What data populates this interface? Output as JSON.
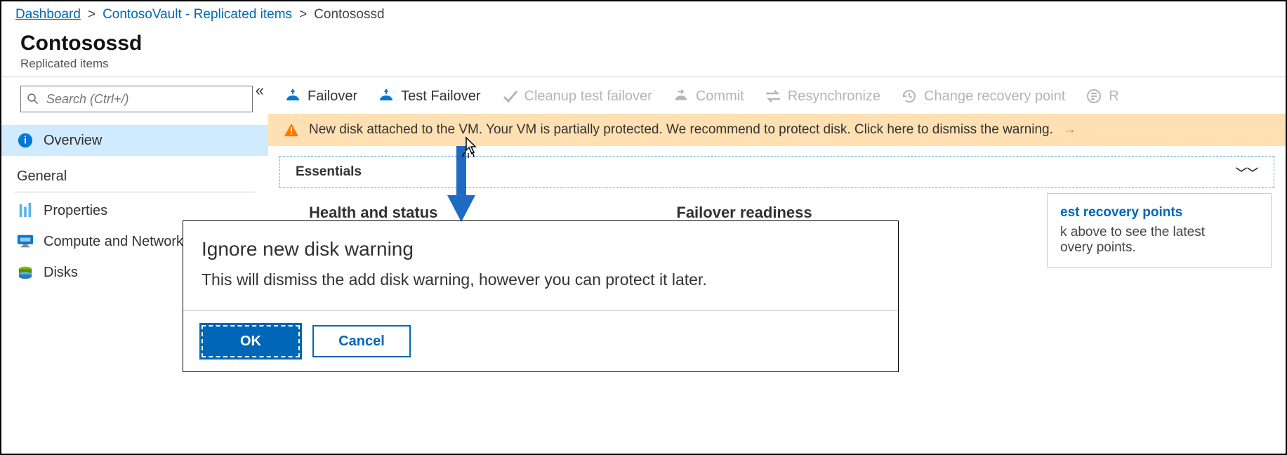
{
  "breadcrumb": {
    "dashboard": "Dashboard",
    "vault": "ContosoVault - Replicated items",
    "current": "Contosossd"
  },
  "header": {
    "title": "Contosossd",
    "subtitle": "Replicated items"
  },
  "search": {
    "placeholder": "Search (Ctrl+/)"
  },
  "sidebar": {
    "overview": "Overview",
    "general_label": "General",
    "properties": "Properties",
    "compute": "Compute and Network",
    "disks": "Disks"
  },
  "toolbar": {
    "failover": "Failover",
    "test_failover": "Test Failover",
    "cleanup": "Cleanup test failover",
    "commit": "Commit",
    "resync": "Resynchronize",
    "change_rp": "Change recovery point",
    "more": "R"
  },
  "banner": {
    "text": "New disk attached to the VM. Your VM is partially protected. We recommend to protect disk. Click here to dismiss the warning."
  },
  "essentials": {
    "label": "Essentials"
  },
  "columns": {
    "health": "Health and status",
    "readiness": "Failover readiness"
  },
  "recovery": {
    "link": "est recovery points",
    "hint1": "k above to see the latest",
    "hint2": "overy points."
  },
  "dialog": {
    "title": "Ignore new disk warning",
    "body": "This will dismiss the add disk warning, however you can protect it later.",
    "ok": "OK",
    "cancel": "Cancel"
  }
}
